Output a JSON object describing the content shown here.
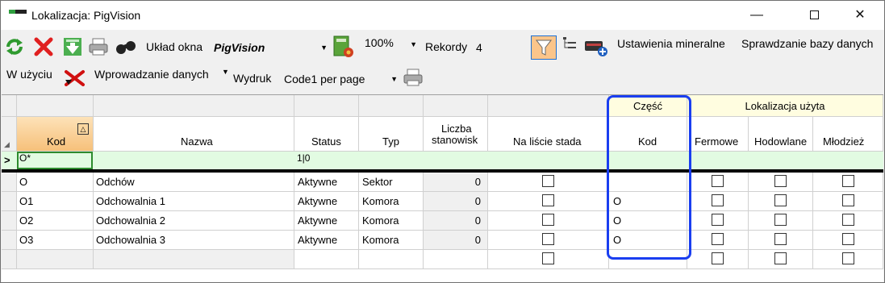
{
  "window": {
    "title": "Lokalizacja: PigVision"
  },
  "toolbar": {
    "layout_label": "Układ okna",
    "layout_value": "PigVision",
    "zoom_value": "100%",
    "records_label": "Rekordy",
    "records_value": "4",
    "mineral_settings": "Ustawienia mineralne",
    "db_check": "Sprawdzanie bazy danych",
    "in_use": "W użyciu",
    "data_entry": "Wprowadzanie danych",
    "print_label": "Wydruk",
    "print_value": "Code1 per page"
  },
  "grid": {
    "group_headers": {
      "part": "Część",
      "used_location": "Lokalizacja użyta"
    },
    "columns": {
      "kod": "Kod",
      "nazwa": "Nazwa",
      "status": "Status",
      "typ": "Typ",
      "liczba_line1": "Liczba",
      "liczba_line2": "stanowisk",
      "na_liscie": "Na liście stada",
      "czesc_kod": "Kod",
      "fermowe": "Fermowe",
      "hodowlane": "Hodowlane",
      "mlodziez": "Młodzież"
    },
    "filter_row": {
      "indicator": ">",
      "kod": "O*",
      "status": "1|0"
    },
    "rows": [
      {
        "kod": "O",
        "nazwa": "Odchów",
        "status": "Aktywne",
        "typ": "Sektor",
        "liczba": "0",
        "czesc_kod": ""
      },
      {
        "kod": "O1",
        "nazwa": "Odchowalnia 1",
        "status": "Aktywne",
        "typ": "Komora",
        "liczba": "0",
        "czesc_kod": "O"
      },
      {
        "kod": "O2",
        "nazwa": "Odchowalnia 2",
        "status": "Aktywne",
        "typ": "Komora",
        "liczba": "0",
        "czesc_kod": "O"
      },
      {
        "kod": "O3",
        "nazwa": "Odchowalnia 3",
        "status": "Aktywne",
        "typ": "Komora",
        "liczba": "0",
        "czesc_kod": "O"
      }
    ]
  },
  "colors": {
    "accent_highlight": "#1a3ef0",
    "header_yellow": "#fffde0",
    "sort_header_orange": "#f6c07a",
    "filter_row_green": "#e2fbe2"
  }
}
